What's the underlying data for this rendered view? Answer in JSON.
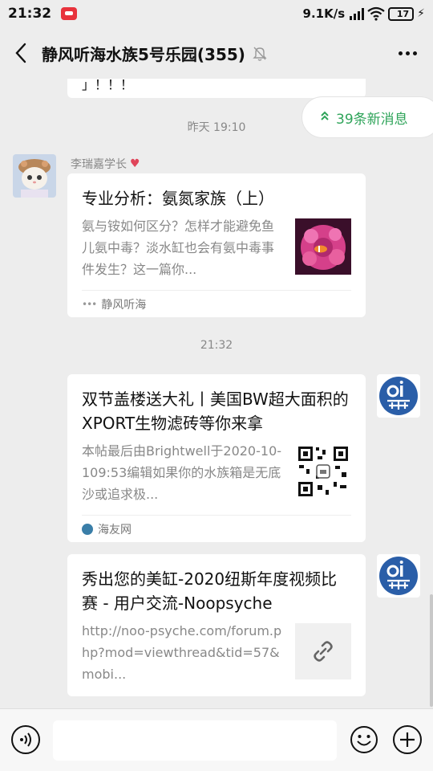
{
  "status_bar": {
    "time": "21:32",
    "network_speed": "9.1K/s",
    "battery_level": "17"
  },
  "header": {
    "title": "静风听海水族5号乐园(355)",
    "back_icon": "chevron-left-icon",
    "mute_icon": "bell-off-icon",
    "more_icon": "ellipsis-icon"
  },
  "new_messages": {
    "label": "39条新消息",
    "icon": "double-chevron-up-icon",
    "color": "#2fa45a"
  },
  "previous_bubble_tail": "」！！！",
  "messages": [
    {
      "timestamp": "昨天 19:10",
      "sender": "李瑞嘉学长",
      "title": "专业分析：氨氮家族（上）",
      "description": "氨与铵如何区分？怎样才能避免鱼儿氨中毒？淡水缸也会有氨中毒事件发生？这一篇你...",
      "source": "静风听海",
      "thumbnail": "coral-photo"
    },
    {
      "timestamp": "21:32",
      "title": "双节盖楼送大礼丨美国BW超大面积的XPORT生物滤砖等你来拿",
      "description": "本帖最后由Brightwell于2020-10-109:53编辑如果你的水族箱是无底沙或追求极...",
      "source": "海友网",
      "thumbnail": "qr-code"
    },
    {
      "title": "秀出您的美缸-2020纽斯年度视频比赛 - 用户交流-Noopsyche",
      "description": "http://noo-psyche.com/forum.php?mod=viewthread&tid=57&mobi...",
      "thumbnail": "link-icon"
    }
  ],
  "input_bar": {
    "voice_icon": "voice-icon",
    "emoji_icon": "emoji-icon",
    "plus_icon": "plus-icon"
  }
}
